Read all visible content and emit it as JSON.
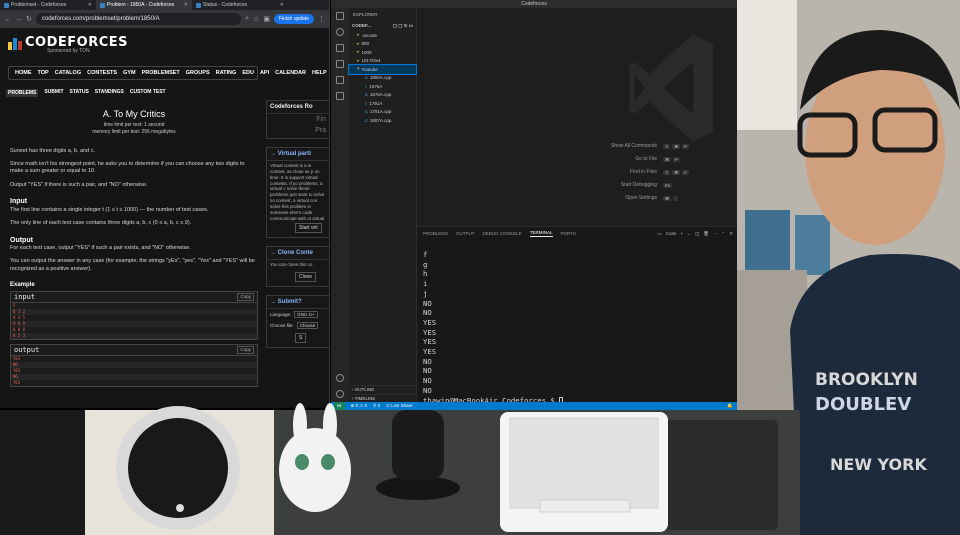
{
  "colors": {
    "cf_logo_yellow": "#f6c43f",
    "cf_logo_blue": "#1a8ad4",
    "cf_logo_red": "#c0392b",
    "vscode_blue": "#007acc",
    "terminal_text": "#d4d4d4",
    "sample_red": "#e06060"
  },
  "browser": {
    "tabs": [
      {
        "label": "Problemset - Codeforces",
        "icon": "codeforces-favicon"
      },
      {
        "label": "Problem - 1850A - Codeforces",
        "icon": "codeforces-favicon"
      },
      {
        "label": "Status - Codeforces",
        "icon": "codeforces-favicon"
      }
    ],
    "url": "codeforces.com/problemset/problem/1850/A",
    "finish_update": "Finish update"
  },
  "codeforces": {
    "logo": "CODEFORCES",
    "sponsored": "Sponsored by TON",
    "menu": [
      "HOME",
      "TOP",
      "CATALOG",
      "CONTESTS",
      "GYM",
      "PROBLEMSET",
      "GROUPS",
      "RATING",
      "EDU",
      "API",
      "CALENDAR",
      "HELP"
    ],
    "submenu": [
      "PROBLEMS",
      "SUBMIT",
      "STATUS",
      "STANDINGS",
      "CUSTOM TEST"
    ],
    "problem": {
      "title": "A. To My Critics",
      "time_limit": "time limit per test: 1 second",
      "memory_limit": "memory limit per test: 256 megabytes",
      "legend_1": "Suneet has three digits a, b, and c.",
      "legend_2": "Since math isn't his strongest point, he asks you to determine if you can choose any two digits to make a sum greater or equal to 10.",
      "legend_3": "Output \"YES\" if there is such a pair, and \"NO\" otherwise.",
      "input_heading": "Input",
      "input_1": "The first line contains a single integer t (1 ≤ t ≤ 1000) — the number of test cases.",
      "input_2": "The only line of each test case contains three digits a, b, c (0 ≤ a, b, c ≤ 9).",
      "output_heading": "Output",
      "output_1": "For each test case, output \"YES\" if such a pair exists, and \"NO\" otherwise.",
      "output_2": "You can output the answer in any case (for example, the strings \"yEs\", \"yes\", \"Yes\" and \"YES\" will be recognized as a positive answer).",
      "example_label": "Example",
      "input_label": "input",
      "output_label": "output",
      "copy_label": "Copy",
      "sample_input": [
        "5",
        "8 1 2",
        "4 4 5",
        "9 9 9",
        "0 0 0",
        "8 5 3"
      ],
      "sample_output": [
        "YES",
        "NO",
        "YES",
        "NO",
        "YES"
      ]
    },
    "sidebar": {
      "round_title": "Codeforces Ro",
      "round_line_1": "Fin",
      "round_line_2": "Pra",
      "virtual_title": "→ Virtual parti",
      "virtual_text": "Virtual contest is a w contest, as close as p on time. It is support virtual contests. If yo problems, a virtual c solve these problems just want to solve so contest, a virtual con solve this problem in someone else's code communicate with ot virtual contest.",
      "virtual_button": "Start virt",
      "clone_title": "→ Clone Conte",
      "clone_text": "You can clone this co",
      "clone_button": "Clone",
      "submit_title": "→ Submit?",
      "language_label": "Language:",
      "language_value": "GNU G+",
      "file_label": "Choose file:",
      "file_button": "Choose",
      "submit_button": "S"
    }
  },
  "vscode": {
    "title": "Codeforces",
    "explorer_title": "EXPLORER",
    "root": "CODEF...",
    "folders": [
      ".vscode",
      "800",
      "1000",
      "1017Div4",
      "Youtube"
    ],
    "files": [
      "1850A.cpp",
      "1676A",
      "1676A.cpp",
      "1791A",
      "1791A.cpp",
      "1807A.cpp"
    ],
    "outline": "OUTLINE",
    "timeline": "TIMELINE",
    "shortcuts": [
      {
        "label": "Show All Commands",
        "keys": [
          "⇧",
          "⌘",
          "P"
        ]
      },
      {
        "label": "Go to File",
        "keys": [
          "⌘",
          "P"
        ]
      },
      {
        "label": "Find in Files",
        "keys": [
          "⇧",
          "⌘",
          "F"
        ]
      },
      {
        "label": "Start Debugging",
        "keys": [
          "F5"
        ]
      },
      {
        "label": "Open Settings",
        "keys": [
          "⌘",
          ","
        ]
      }
    ],
    "panel_tabs": [
      "PROBLEMS",
      "OUTPUT",
      "DEBUG CONSOLE",
      "TERMINAL",
      "PORTS"
    ],
    "panel_tool_label": "Code",
    "terminal_lines": [
      "f",
      "g",
      "h",
      "i",
      "j",
      "NO",
      "NO",
      "YES",
      "YES",
      "YES",
      "YES",
      "NO",
      "NO",
      "NO",
      "NO"
    ],
    "prompt": "thawin@MacBookAir Codeforces $ ",
    "status": {
      "problems": "⊗ 0 ⚠ 0",
      "ports": "⚲ 0",
      "live_server": "⊙ Live Share"
    }
  }
}
